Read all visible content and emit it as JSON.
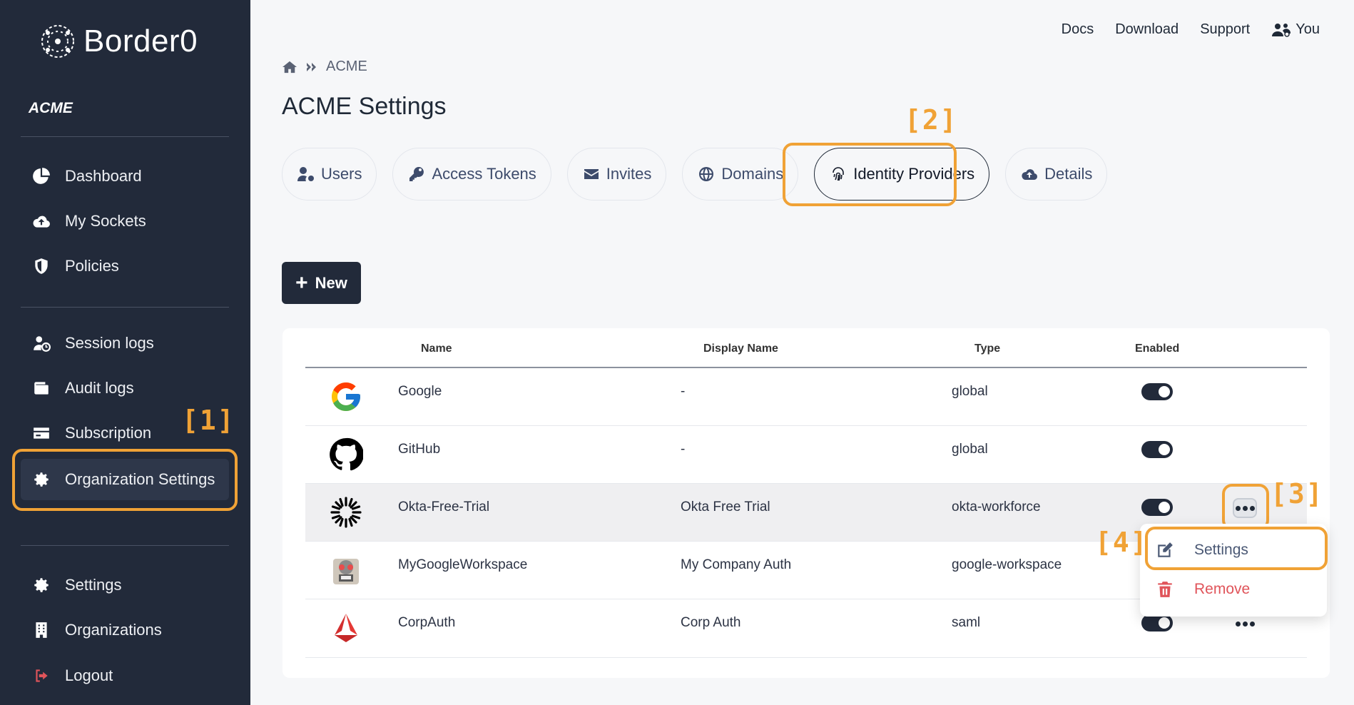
{
  "brand": {
    "name": "Border0"
  },
  "sidebar": {
    "org_name": "ACME",
    "items": [
      {
        "label": "Dashboard",
        "icon": "pie-chart-icon"
      },
      {
        "label": "My Sockets",
        "icon": "cloud-upload-icon"
      },
      {
        "label": "Policies",
        "icon": "shield-icon"
      },
      {
        "label": "Session logs",
        "icon": "user-clock-icon"
      },
      {
        "label": "Audit logs",
        "icon": "wallet-icon"
      },
      {
        "label": "Subscription",
        "icon": "credit-card-icon"
      },
      {
        "label": "Organization Settings",
        "icon": "gear-icon",
        "active": true
      },
      {
        "label": "Settings",
        "icon": "gear-icon"
      },
      {
        "label": "Organizations",
        "icon": "building-icon"
      },
      {
        "label": "Logout",
        "icon": "sign-out-icon"
      }
    ]
  },
  "topnav": {
    "docs": "Docs",
    "download": "Download",
    "support": "Support",
    "user": "You"
  },
  "breadcrumb": {
    "current": "ACME"
  },
  "page": {
    "title": "ACME Settings"
  },
  "tabs": [
    {
      "label": "Users",
      "icon": "user-cog-icon"
    },
    {
      "label": "Access Tokens",
      "icon": "key-icon"
    },
    {
      "label": "Invites",
      "icon": "envelope-icon"
    },
    {
      "label": "Domains",
      "icon": "globe-icon"
    },
    {
      "label": "Identity Providers",
      "icon": "fingerprint-icon",
      "active": true
    },
    {
      "label": "Details",
      "icon": "cloud-upload-icon"
    }
  ],
  "new_button": {
    "label": "New"
  },
  "table": {
    "columns": {
      "name": "Name",
      "display_name": "Display Name",
      "type": "Type",
      "enabled": "Enabled"
    },
    "rows": [
      {
        "name": "Google",
        "display_name": "-",
        "type": "global",
        "enabled": true,
        "logo": "google-logo"
      },
      {
        "name": "GitHub",
        "display_name": "-",
        "type": "global",
        "enabled": true,
        "logo": "github-logo"
      },
      {
        "name": "Okta-Free-Trial",
        "display_name": "Okta Free Trial",
        "type": "okta-workforce",
        "enabled": true,
        "logo": "okta-logo"
      },
      {
        "name": "MyGoogleWorkspace",
        "display_name": "My Company Auth",
        "type": "google-workspace",
        "enabled": true,
        "logo": "workspace-avatar"
      },
      {
        "name": "CorpAuth",
        "display_name": "Corp Auth",
        "type": "saml",
        "enabled": true,
        "logo": "corpauth-logo"
      }
    ]
  },
  "row_menu": {
    "settings": "Settings",
    "remove": "Remove"
  },
  "annotations": {
    "a1": "[1]",
    "a2": "[2]",
    "a3": "[3]",
    "a4": "[4]"
  },
  "colors": {
    "sidebar_bg": "#222a3a",
    "annotation": "#f0a236",
    "danger": "#e0545a"
  }
}
